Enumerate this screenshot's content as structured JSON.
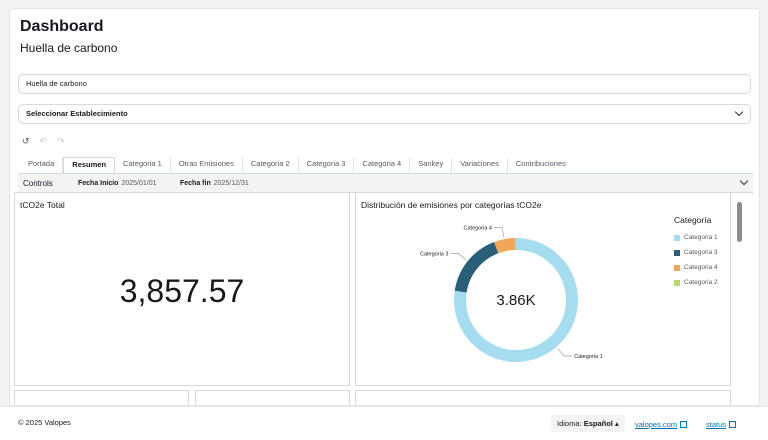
{
  "header": {
    "title": "Dashboard",
    "subtitle": "Huella de carbono"
  },
  "fields": {
    "dashboard_name": "Huella de carbono",
    "establishment_select": "Seleccionar Establecimiento"
  },
  "toolbar": {
    "reset_icon": "reset-icon",
    "undo_icon": "undo-icon",
    "redo_icon": "redo-icon"
  },
  "tabs": [
    {
      "label": "Portada"
    },
    {
      "label": "Resumen",
      "active": true
    },
    {
      "label": "Categoria 1"
    },
    {
      "label": "Otras Emisiones"
    },
    {
      "label": "Categoria 2"
    },
    {
      "label": "Categoria 3"
    },
    {
      "label": "Categoria 4"
    },
    {
      "label": "Sankey"
    },
    {
      "label": "Variaciones"
    },
    {
      "label": "Contribuciones"
    }
  ],
  "controls": {
    "label": "Controls",
    "start_label": "Fecha Inicio",
    "start_value": "2025/01/01",
    "end_label": "Fecha fin",
    "end_value": "2025/12/31"
  },
  "kpi": {
    "title": "tCO2e Total",
    "value": "3,857.57"
  },
  "chart_data": {
    "type": "pie",
    "title": "Distribución de emisiones por categorías tCO2e",
    "center_label": "3.86K",
    "legend_title": "Categoría",
    "legend_position": "right",
    "slices": [
      {
        "name": "Categoria 1",
        "value": 2985,
        "color": "#a6dcef"
      },
      {
        "name": "Categoria 3",
        "value": 650,
        "color": "#2a5f7a"
      },
      {
        "name": "Categoria 4",
        "value": 210,
        "color": "#f2a65a"
      },
      {
        "name": "Categoria 2",
        "value": 12,
        "color": "#b5d96b"
      }
    ]
  },
  "footer": {
    "copyright": "© 2025 Valopes",
    "language_label": "Idioma:",
    "language_value": "Español",
    "link1": "valopes.com",
    "link2": "status"
  }
}
